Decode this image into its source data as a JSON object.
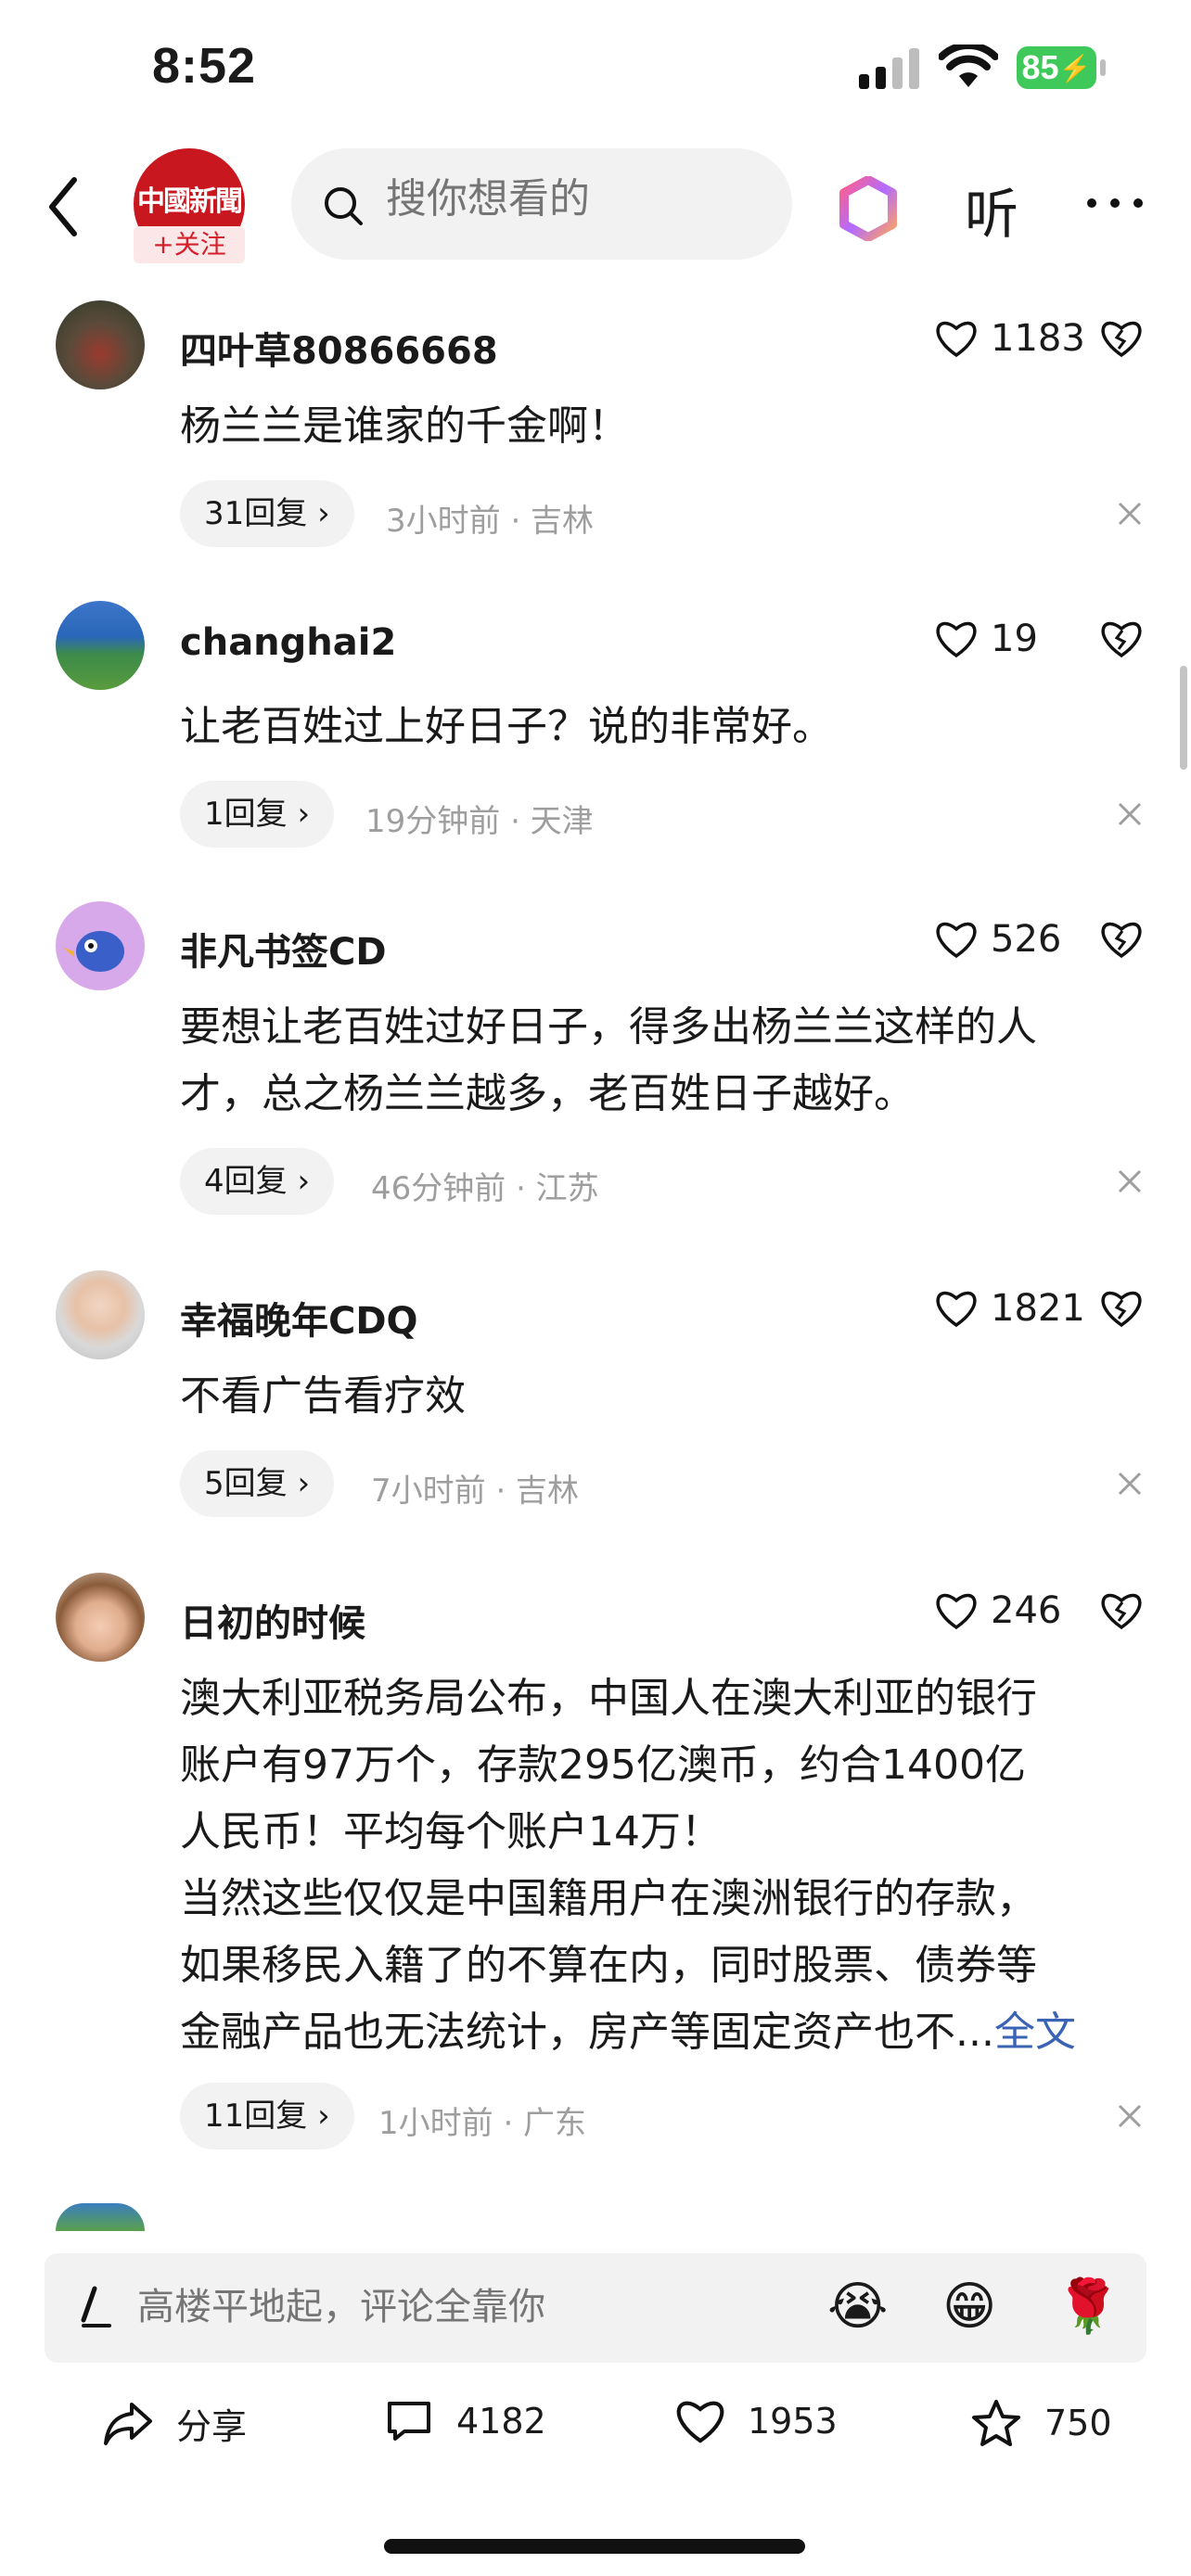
{
  "status_bar": {
    "time": "8:52",
    "battery": "85"
  },
  "header": {
    "logo_text": "中國新聞",
    "follow_label": "+关注",
    "search_placeholder": "搜你想看的",
    "listen_label": "听"
  },
  "comments": [
    {
      "user": "四叶草80866668",
      "likes": "1183",
      "text": [
        "杨兰兰是谁家的千金啊！"
      ],
      "replies": "31回复",
      "meta": "3小时前 · 吉林"
    },
    {
      "user": "changhai2",
      "likes": "19",
      "text": [
        "让老百姓过上好日子？说的非常好。"
      ],
      "replies": "1回复",
      "meta": "19分钟前 · 天津"
    },
    {
      "user": "非凡书签CD",
      "likes": "526",
      "text": [
        "要想让老百姓过好日子，得多出杨兰兰这样的人",
        "才，总之杨兰兰越多，老百姓日子越好。"
      ],
      "replies": "4回复",
      "meta": "46分钟前 · 江苏"
    },
    {
      "user": "幸福晚年CDQ",
      "likes": "1821",
      "text": [
        "不看广告看疗效"
      ],
      "replies": "5回复",
      "meta": "7小时前 · 吉林"
    },
    {
      "user": "日初的时候",
      "likes": "246",
      "text": [
        "澳大利亚税务局公布，中国人在澳大利亚的银行",
        "账户有97万个，存款295亿澳币，约合1400亿",
        "人民币！平均每个账户14万！",
        "当然这些仅仅是中国籍用户在澳洲银行的存款，",
        "如果移民入籍了的不算在内，同时股票、债券等",
        "金融产品也无法统计，房产等固定资产也不..."
      ],
      "full_text_link": "全文",
      "replies": "11回复",
      "meta": "1小时前 · 广东"
    }
  ],
  "composer": {
    "placeholder": "高楼平地起，评论全靠你",
    "emojis": [
      "😭",
      "😁",
      "🌹"
    ]
  },
  "actions": {
    "share_label": "分享",
    "comments_count": "4182",
    "likes_count": "1953",
    "favorites_count": "750"
  }
}
